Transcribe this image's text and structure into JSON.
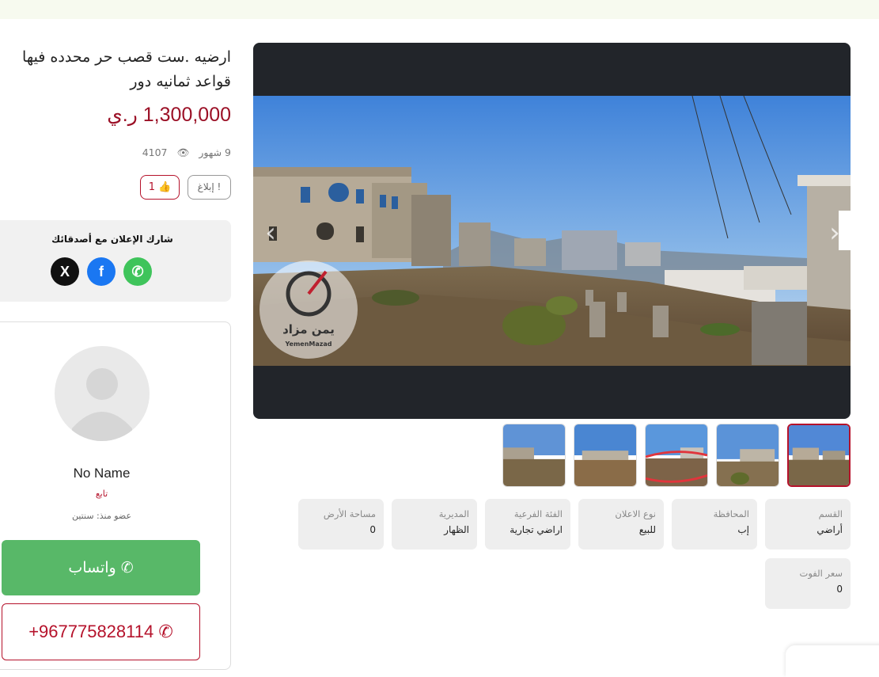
{
  "listing": {
    "title": "ارضيه .ست قصب حر محدده فيها قواعد ثمانيه دور",
    "price": "1,300,000 ر.ي",
    "age": "9 شهور",
    "views": "4107",
    "report_label": "إبلاغ",
    "likes": "1"
  },
  "gallery": {
    "prev_icon": "chevron-left-icon",
    "next_icon": "chevron-right-icon",
    "watermark_ar": "يمن مزاد",
    "watermark_en": "YemenMazad",
    "thumbnail_count": 5,
    "active_thumbnail": 5
  },
  "share": {
    "title": "شارك الإعلان مع أصدقائك",
    "x_glyph": "X",
    "facebook_glyph": "f",
    "whatsapp_glyph": "✆",
    "icons": [
      "x-icon",
      "facebook-icon",
      "whatsapp-icon"
    ]
  },
  "details": [
    {
      "label": "القسم",
      "value": "أراضي"
    },
    {
      "label": "المحافظة",
      "value": "إب"
    },
    {
      "label": "نوع الاعلان",
      "value": "للبيع"
    },
    {
      "label": "الفئة الفرعية",
      "value": "اراضي تجارية"
    },
    {
      "label": "المديرية",
      "value": "الظهار"
    },
    {
      "label": "مساحة الأرض",
      "value": "0"
    },
    {
      "label": "سعر الفوت",
      "value": "0"
    }
  ],
  "seller": {
    "name": "No Name",
    "role": "تابع",
    "member_since": "عضو منذ: سنتين",
    "whatsapp_label": "واتساب",
    "phone": "+967775828114"
  },
  "colors": {
    "accent": "#b5122b",
    "price": "#9b1026",
    "whatsapp": "#58b868",
    "gallery_bg": "#22252a"
  }
}
